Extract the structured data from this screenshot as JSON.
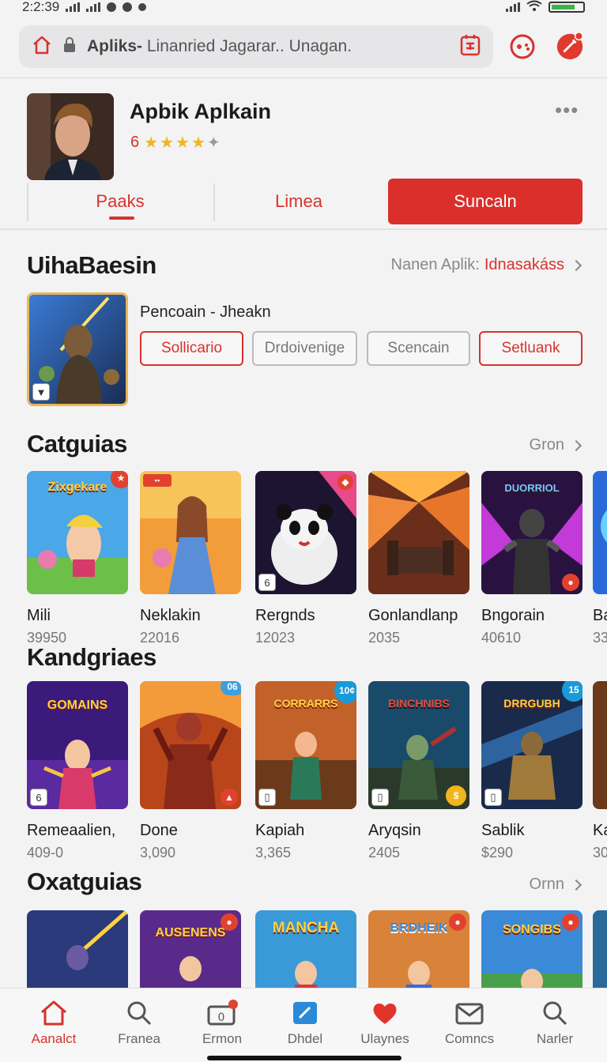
{
  "status": {
    "time": "2:2:39"
  },
  "browser": {
    "url_prefix": "Apliks-",
    "url_rest": "Linanried Jagarar.. Unagan."
  },
  "app": {
    "title": "Apbik Aplkain",
    "rating": "6",
    "stars": 4,
    "tabs": {
      "tab1": "Paaks",
      "tab2": "Limea"
    },
    "cta": "Suncaln"
  },
  "section1": {
    "title": "UihaBaesin",
    "link_label": "Nanen Aplik:",
    "link_accent": "Idnasakáss",
    "featured_subtitle": "Pencoain - Jheakn",
    "chips": [
      "Sollicario",
      "Drdoivenige",
      "Scencain",
      "Setluank"
    ]
  },
  "section2": {
    "title": "Catguias",
    "link": "Gron",
    "cards": [
      {
        "name": "Mili",
        "count": "39950",
        "art": "Zixgekare"
      },
      {
        "name": "Neklakin",
        "count": "22016",
        "art": ""
      },
      {
        "name": "Rergnds",
        "count": "12023",
        "art": ""
      },
      {
        "name": "Gonlandlanp",
        "count": "2035",
        "art": ""
      },
      {
        "name": "Bngorain",
        "count": "40610",
        "art": "DUORRIOL"
      },
      {
        "name": "Ba",
        "count": "33",
        "art": ""
      }
    ]
  },
  "section3": {
    "title": "Kandgriaes",
    "cards": [
      {
        "name": "Remeaalien,",
        "count": "409-0",
        "art": "GOMAINS",
        "badge": ""
      },
      {
        "name": "Done",
        "count": "3,090",
        "art": "",
        "badge": "06"
      },
      {
        "name": "Kapiah",
        "count": "3,365",
        "art": "CORRARRS",
        "badge": "10¢"
      },
      {
        "name": "Aryqsin",
        "count": "2405",
        "art": "BINCHNIBS",
        "badge": ""
      },
      {
        "name": "Sablik",
        "count": "$290",
        "art": "DRRGUBH",
        "badge": "15"
      },
      {
        "name": "Ka",
        "count": "30",
        "art": "",
        "badge": ""
      }
    ]
  },
  "section4": {
    "title": "Oxatguias",
    "link": "Ornn",
    "cards": [
      {
        "art": ""
      },
      {
        "art": "AUSENENS"
      },
      {
        "art": "MANCHA"
      },
      {
        "art": "BRDHEIK"
      },
      {
        "art": "SONGIBS"
      }
    ]
  },
  "nav": {
    "items": [
      "Aanalct",
      "Franea",
      "Ermon",
      "Dhdel",
      "Ulaynes",
      "Comncs",
      "Narler"
    ],
    "active_index": 0
  },
  "colors": {
    "accent": "#d8322c",
    "star": "#f2b51c"
  }
}
